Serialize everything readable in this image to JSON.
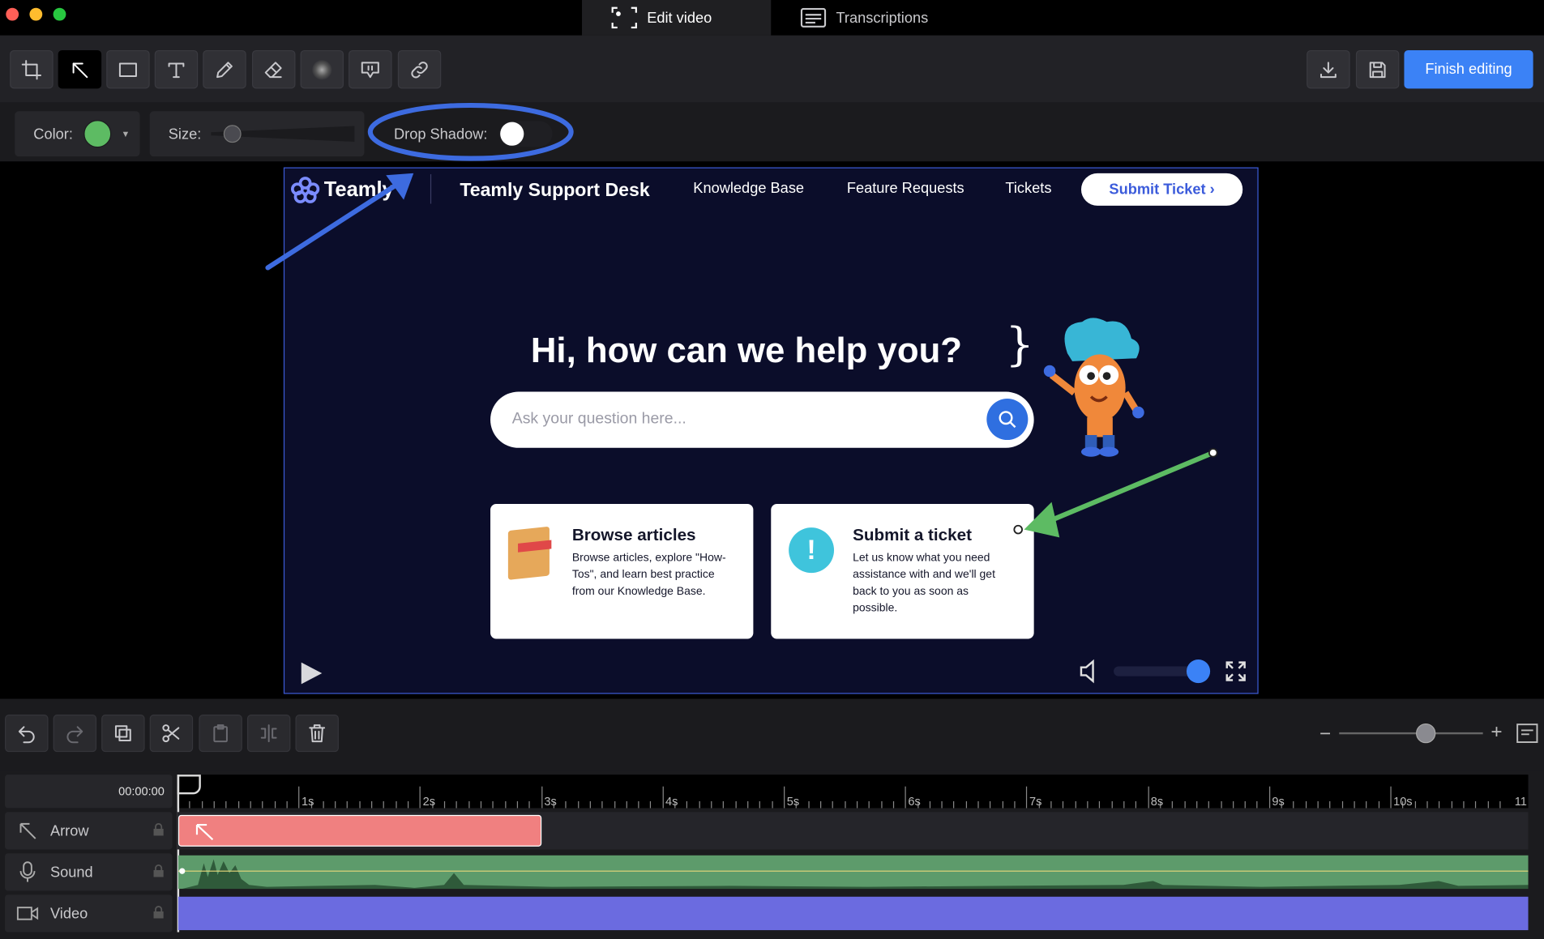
{
  "tabs": [
    {
      "label": "Edit video",
      "icon": "edit-video-icon"
    },
    {
      "label": "Transcriptions",
      "icon": "transcriptions-icon"
    }
  ],
  "toolbar": {
    "tools": [
      "crop-icon",
      "arrow-icon",
      "rectangle-icon",
      "text-icon",
      "pencil-icon",
      "eraser-icon",
      "blur-icon",
      "callout-icon",
      "link-icon"
    ],
    "download": "download-icon",
    "save": "save-icon",
    "finish_label": "Finish editing"
  },
  "props": {
    "color_label": "Color:",
    "color_value": "#5dbb63",
    "size_label": "Size:",
    "size_value": 0.1,
    "shadow_label": "Drop Shadow:",
    "shadow_on": false
  },
  "preview": {
    "brand": "Teamly",
    "site_title": "Teamly Support Desk",
    "nav": [
      "Knowledge Base",
      "Feature Requests",
      "Tickets"
    ],
    "cta": "Submit Ticket ›",
    "headline": "Hi, how can we help you?",
    "search_placeholder": "Ask your question here...",
    "cards": [
      {
        "title": "Browse articles",
        "text": "Browse articles, explore \"How-Tos\", and learn best practice from our Knowledge Base."
      },
      {
        "title": "Submit a ticket",
        "text": "Let us know what you need assistance with and we'll get back to you as soon as possible."
      }
    ],
    "volume": 1.0
  },
  "timeline": {
    "time": "00:00:00",
    "zoom": 0.62,
    "ticks": [
      "1s",
      "2s",
      "3s",
      "4s",
      "5s",
      "6s",
      "7s",
      "8s",
      "9s",
      "10s",
      "11"
    ],
    "tracks": [
      {
        "label": "Arrow",
        "icon": "arrow-icon"
      },
      {
        "label": "Sound",
        "icon": "microphone-icon"
      },
      {
        "label": "Video",
        "icon": "video-icon"
      }
    ],
    "arrow_clip": {
      "start_s": 0,
      "end_s": 3.0
    },
    "colors": {
      "arrow_clip": "#f08080",
      "sound": "#5d9b6b",
      "video": "#6b6be0"
    }
  }
}
